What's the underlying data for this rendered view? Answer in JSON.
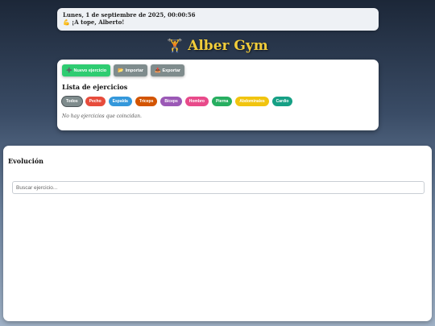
{
  "status": {
    "datetime": "Lunes, 1 de septiembre de 2025, 00:00:56",
    "greeting_emoji": "💪",
    "greeting": "¡A tope, Alberto!"
  },
  "brand": {
    "icon": "🏋️",
    "title": "Alber Gym"
  },
  "toolbar": {
    "new_icon": "➕",
    "new_label": "Nuevo ejercicio",
    "import_icon": "📂",
    "import_label": "Importar",
    "export_icon": "📤",
    "export_label": "Exportar"
  },
  "list": {
    "title": "Lista de ejercicios",
    "filters": [
      {
        "label": "Todos",
        "color": "#7f8c8d"
      },
      {
        "label": "Pecho",
        "color": "#e74c3c"
      },
      {
        "label": "Espalda",
        "color": "#3498db"
      },
      {
        "label": "Tríceps",
        "color": "#d35400"
      },
      {
        "label": "Bíceps",
        "color": "#9b59b6"
      },
      {
        "label": "Hombro",
        "color": "#e84a8a"
      },
      {
        "label": "Pierna",
        "color": "#27ae60"
      },
      {
        "label": "Abdominales",
        "color": "#f1c40f"
      },
      {
        "label": "Cardio",
        "color": "#16a085"
      }
    ],
    "empty_message": "No hay ejercicios que coincidan."
  },
  "evolution": {
    "title": "Evolución",
    "search_placeholder": "Buscar ejercicio..."
  },
  "colors": {
    "new_button": "#2ecc71",
    "import_button": "#7f8c8d",
    "export_button": "#7f8c8d",
    "brand_title": "#f2cd3a"
  }
}
